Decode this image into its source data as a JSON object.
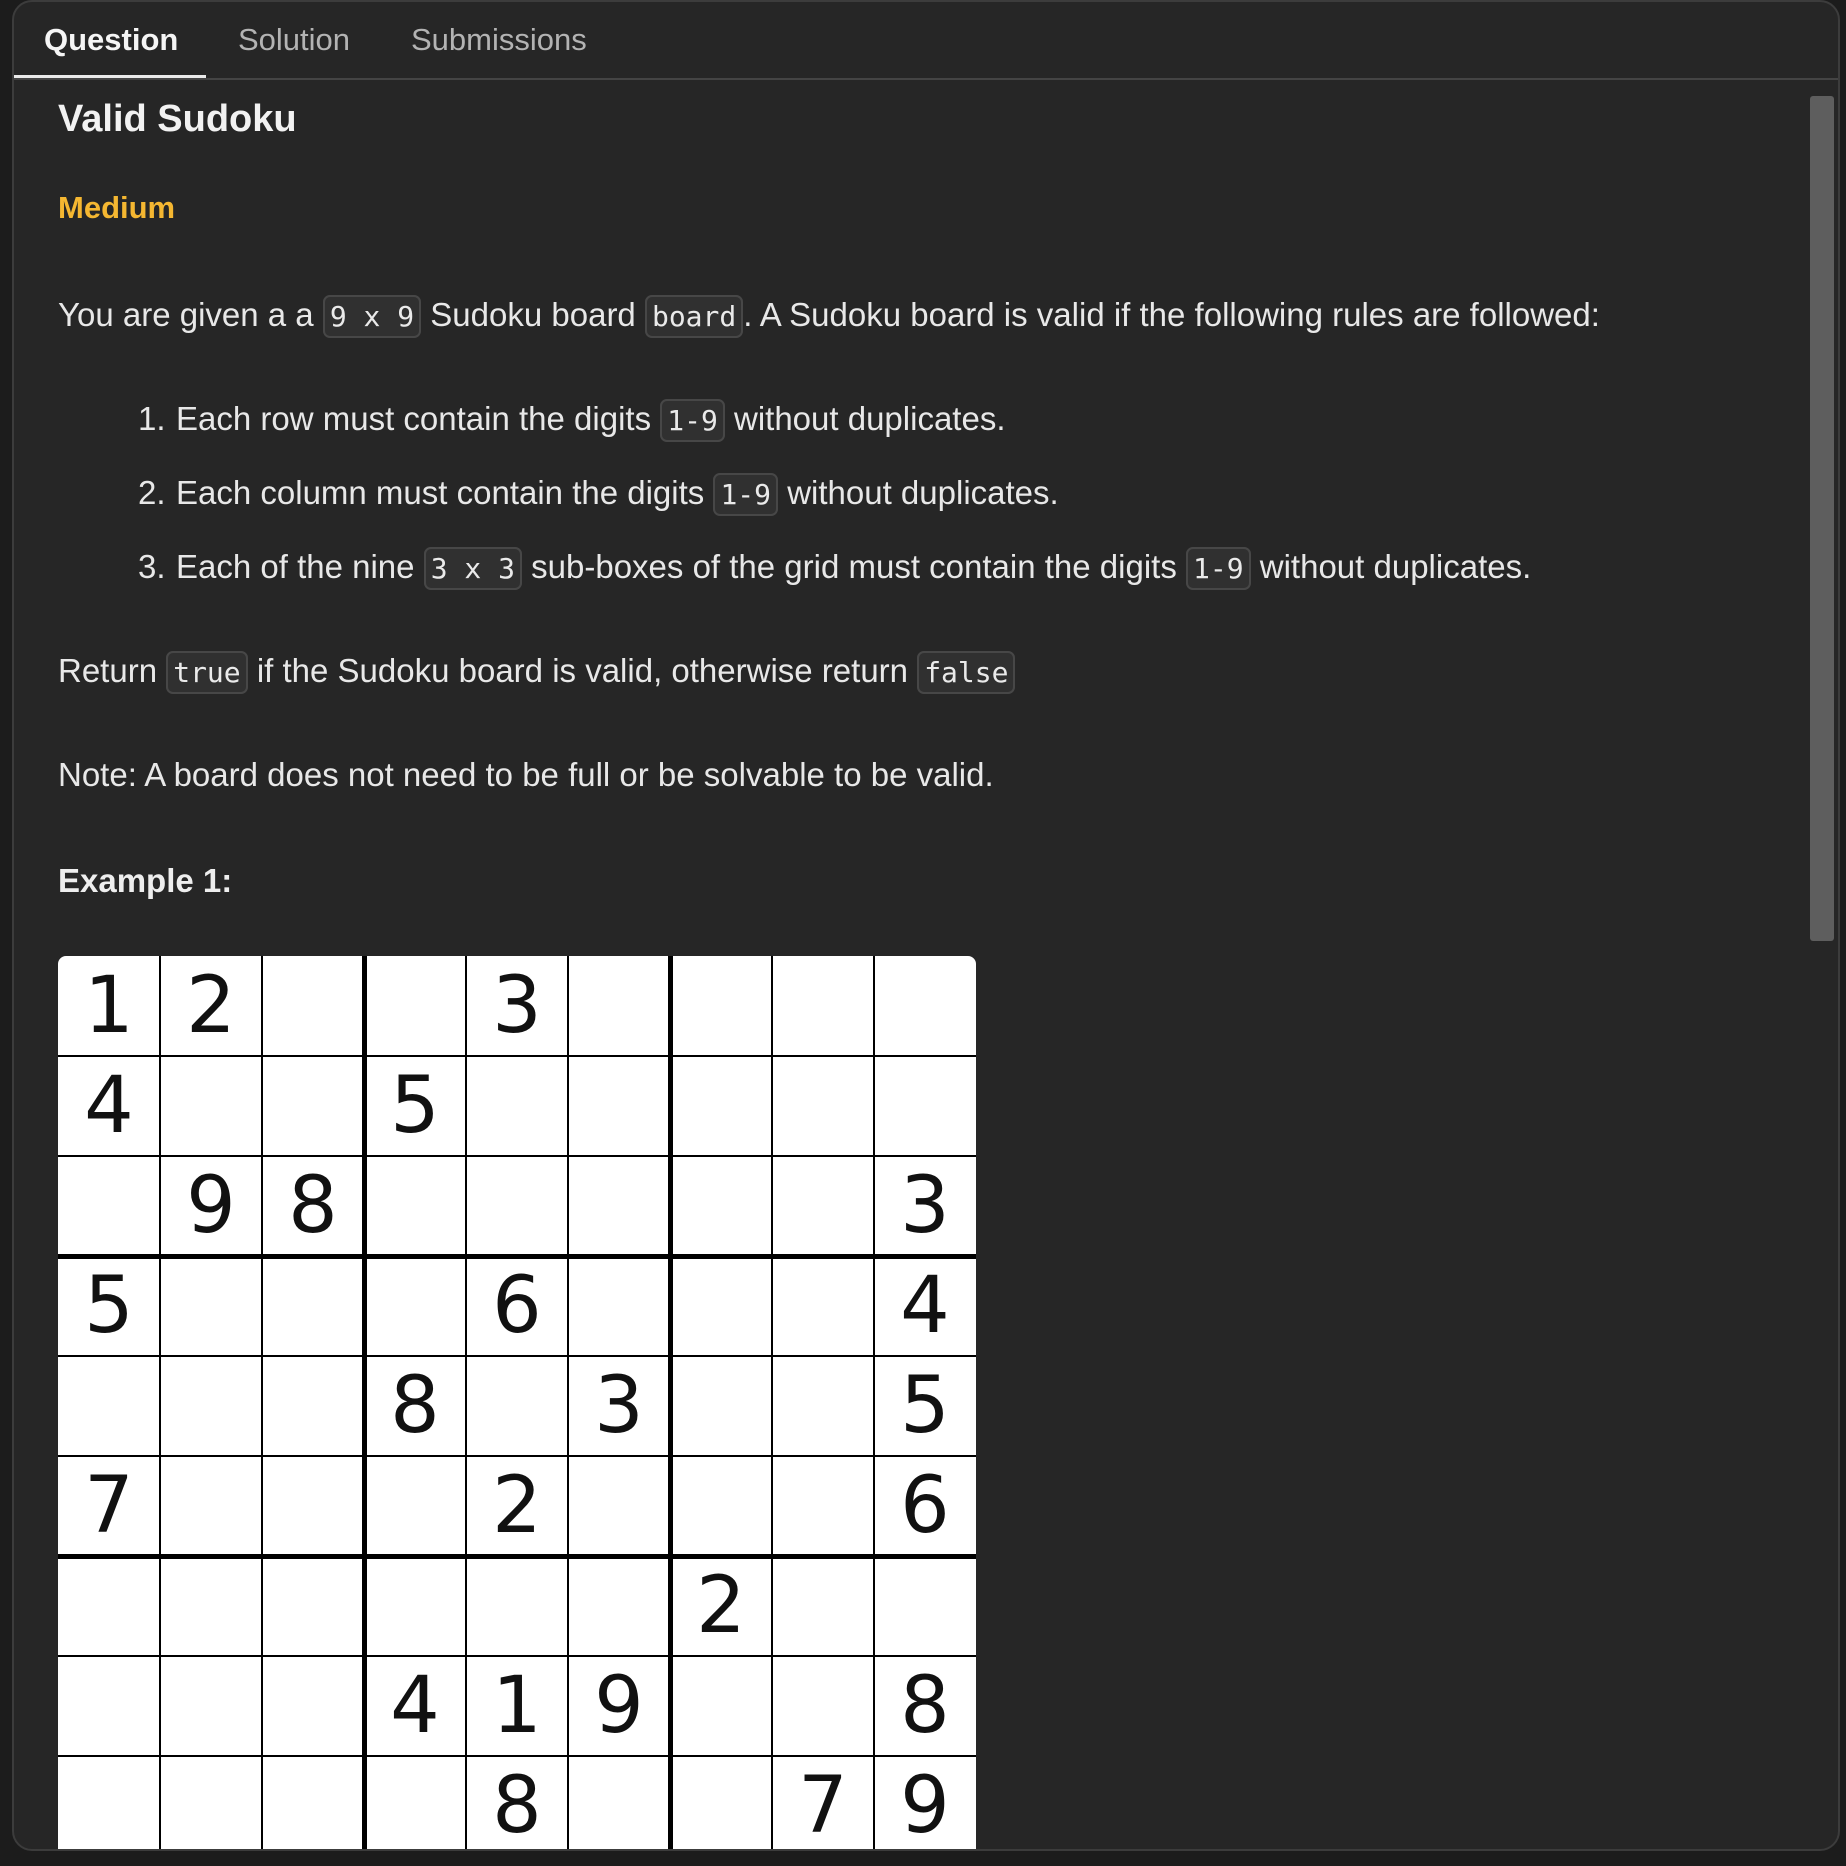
{
  "tabs": [
    {
      "label": "Question",
      "active": true
    },
    {
      "label": "Solution",
      "active": false
    },
    {
      "label": "Submissions",
      "active": false
    }
  ],
  "problem": {
    "title": "Valid Sudoku",
    "difficulty": "Medium",
    "difficulty_color": "#f5b731",
    "intro": {
      "part1": "You are given a a ",
      "code1": "9 x 9",
      "part2": " Sudoku board ",
      "code2": "board",
      "part3": ". A Sudoku board is valid if the following rules are followed:"
    },
    "rules": [
      {
        "num": "1.",
        "text1": "Each row must contain the digits ",
        "code1": "1-9",
        "text2": " without duplicates."
      },
      {
        "num": "2.",
        "text1": "Each column must contain the digits ",
        "code1": "1-9",
        "text2": " without duplicates."
      },
      {
        "num": "3.",
        "text1": "Each of the nine ",
        "code1": "3 x 3",
        "text2": " sub-boxes of the grid must contain the digits ",
        "code2": "1-9",
        "text3": " without duplicates."
      }
    ],
    "return_text": {
      "part1": "Return ",
      "code1": "true",
      "part2": " if the Sudoku board is valid, otherwise return ",
      "code2": "false"
    },
    "note": "Note: A board does not need to be full or be solvable to be valid.",
    "example_heading": "Example 1:"
  },
  "board": [
    [
      "1",
      "2",
      "",
      "",
      "3",
      "",
      "",
      "",
      ""
    ],
    [
      "4",
      "",
      "",
      "5",
      "",
      "",
      "",
      "",
      ""
    ],
    [
      "",
      "9",
      "8",
      "",
      "",
      "",
      "",
      "",
      "3"
    ],
    [
      "5",
      "",
      "",
      "",
      "6",
      "",
      "",
      "",
      "4"
    ],
    [
      "",
      "",
      "",
      "8",
      "",
      "3",
      "",
      "",
      "5"
    ],
    [
      "7",
      "",
      "",
      "",
      "2",
      "",
      "",
      "",
      "6"
    ],
    [
      "",
      "",
      "",
      "",
      "",
      "",
      "2",
      "",
      ""
    ],
    [
      "",
      "",
      "",
      "4",
      "1",
      "9",
      "",
      "",
      "8"
    ],
    [
      "",
      "",
      "",
      "",
      "8",
      "",
      "",
      "7",
      "9"
    ]
  ]
}
